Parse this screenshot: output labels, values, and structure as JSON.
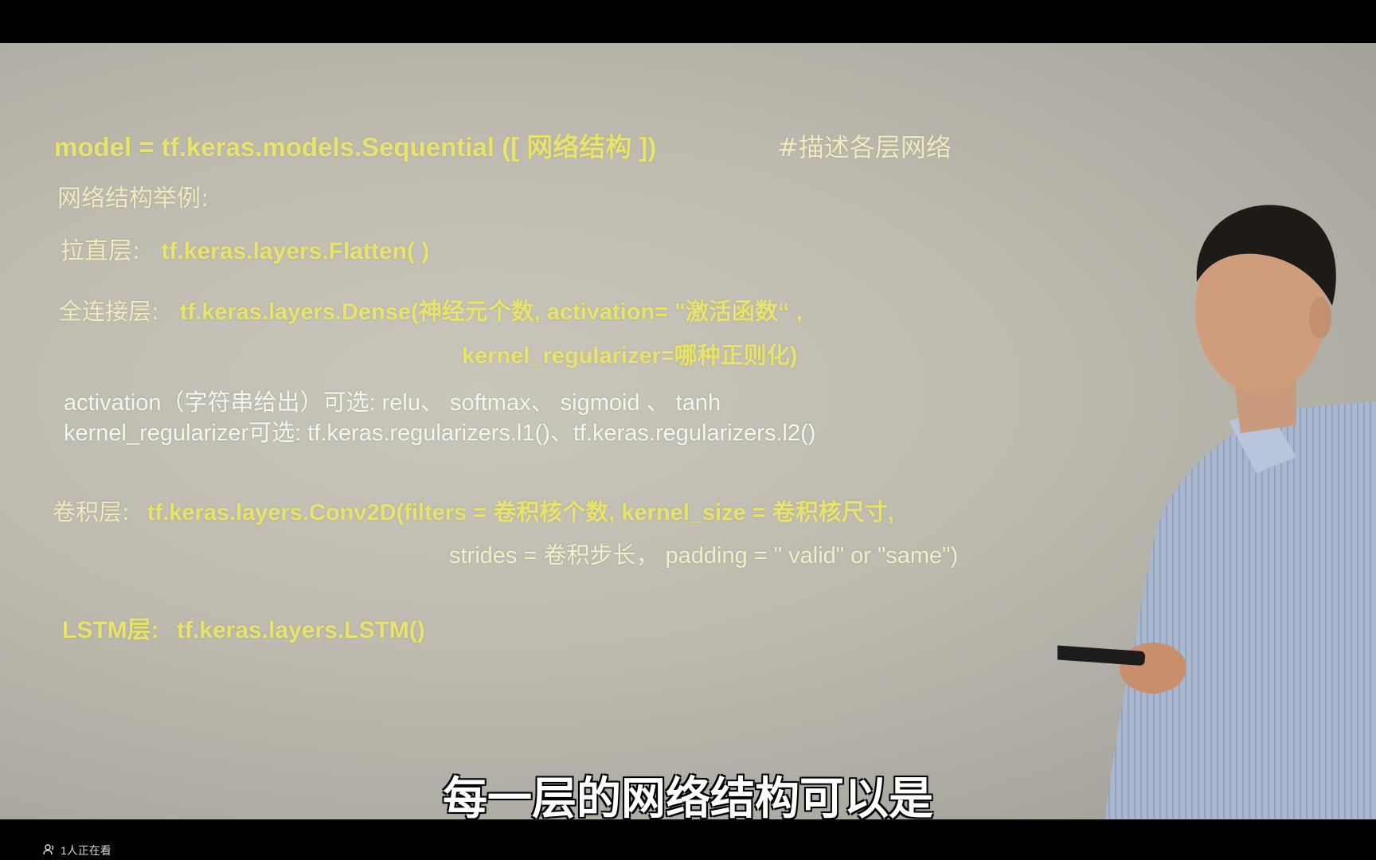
{
  "slide": {
    "model_code": "model = tf.keras.models.Sequential ([ 网络结构 ])",
    "model_comment": "#描述各层网络",
    "examples_title": "网络结构举例:",
    "flatten_label": "拉直层:",
    "flatten_code": "tf.keras.layers.Flatten( )",
    "dense_label": "全连接层:",
    "dense_code_line1": "tf.keras.layers.Dense(神经元个数, activation= \"激活函数“ ,",
    "dense_code_line2": "kernel_regularizer=哪种正则化)",
    "activation_options": "activation（字符串给出）可选: relu、 softmax、 sigmoid 、 tanh",
    "regularizer_options": "kernel_regularizer可选: tf.keras.regularizers.l1()、tf.keras.regularizers.l2()",
    "conv_label": "卷积层:",
    "conv_code_line1": "tf.keras.layers.Conv2D(filters = 卷积核个数, kernel_size = 卷积核尺寸,",
    "conv_code_line2": "strides = 卷积步长， padding = \" valid\" or \"same\")",
    "lstm_label": "LSTM层:",
    "lstm_code": "tf.keras.layers.LSTM()"
  },
  "subtitle": "每一层的网络结构可以是",
  "viewer_count": "1人正在看",
  "icons": [
    "viewers-icon"
  ],
  "colors": {
    "code": "#e8e36e",
    "background": "#bdbab0",
    "bars": "#000000"
  }
}
